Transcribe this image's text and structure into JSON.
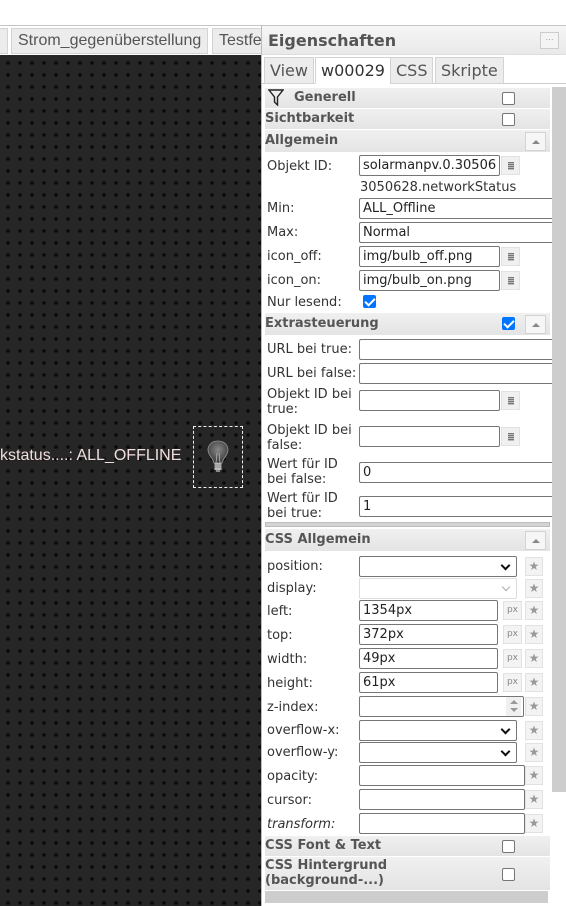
{
  "editor": {
    "view_tabs": [
      {
        "label": ""
      },
      {
        "label": "Strom_gegenüberstellung"
      },
      {
        "label": "Testfe"
      }
    ],
    "widget_text": "kstatus....: ALL_OFFLINE",
    "bulb_icon": "lightbulb-icon"
  },
  "panel": {
    "title": "Eigenschaften",
    "menu_glyph": "⋯",
    "tabs": [
      {
        "label": "View",
        "active": false
      },
      {
        "label": "w00029",
        "active": true
      },
      {
        "label": "CSS",
        "active": false
      },
      {
        "label": "Skripte",
        "active": false
      }
    ],
    "groups": {
      "generell": {
        "label": "Generell",
        "icon": "filter-icon",
        "checked": false
      },
      "sichtbarkeit": {
        "label": "Sichtbarkeit",
        "checked": false
      },
      "allgemein": {
        "label": "Allgemein"
      },
      "extrasteuerung": {
        "label": "Extrasteuerung",
        "checked": true
      },
      "css_allgemein": {
        "label": "CSS Allgemein"
      },
      "css_font": {
        "label": "CSS Font & Text",
        "checked": false
      },
      "css_hintergrund": {
        "label": "CSS Hintergrund (background-...)",
        "label_line1": "CSS Hintergrund",
        "label_line2": "(background-...)",
        "checked": false
      }
    },
    "allgemein": {
      "objekt_id": {
        "label": "Objekt ID:",
        "value": "solarmanpv.0.30506",
        "full_suffix": "3050628.networkStatus"
      },
      "min": {
        "label": "Min:",
        "value": "ALL_Offline"
      },
      "max": {
        "label": "Max:",
        "value": "Normal"
      },
      "icon_off": {
        "label": "icon_off:",
        "value": "img/bulb_off.png"
      },
      "icon_on": {
        "label": "icon_on:",
        "value": "img/bulb_on.png"
      },
      "nur_lesend": {
        "label": "Nur lesend:",
        "checked": true
      }
    },
    "extrasteuerung": {
      "url_true": {
        "label": "URL bei true:",
        "value": ""
      },
      "url_false": {
        "label": "URL bei false:",
        "value": ""
      },
      "oid_true": {
        "label_line1": "Objekt ID bei",
        "label_line2": "true:",
        "value": ""
      },
      "oid_false": {
        "label_line1": "Objekt ID bei",
        "label_line2": "false:",
        "value": ""
      },
      "wert_false": {
        "label_line1": "Wert für ID",
        "label_line2": "bei false:",
        "value": "0"
      },
      "wert_true": {
        "label_line1": "Wert für ID",
        "label_line2": "bei true:",
        "value": "1"
      }
    },
    "css_allgemein": {
      "position": {
        "label": "position:",
        "value": ""
      },
      "display": {
        "label": "display:",
        "value": ""
      },
      "left": {
        "label": "left:",
        "value": "1354px"
      },
      "top": {
        "label": "top:",
        "value": "372px"
      },
      "width": {
        "label": "width:",
        "value": "49px"
      },
      "height": {
        "label": "height:",
        "value": "61px"
      },
      "z_index": {
        "label": "z-index:",
        "value": ""
      },
      "overflow_x": {
        "label": "overflow-x:",
        "value": ""
      },
      "overflow_y": {
        "label": "overflow-y:",
        "value": ""
      },
      "opacity": {
        "label": "opacity:",
        "value": ""
      },
      "cursor": {
        "label": "cursor:",
        "value": ""
      },
      "transform": {
        "label": "transform:",
        "value": ""
      }
    },
    "unit_label": "px",
    "star_glyph": "★"
  }
}
